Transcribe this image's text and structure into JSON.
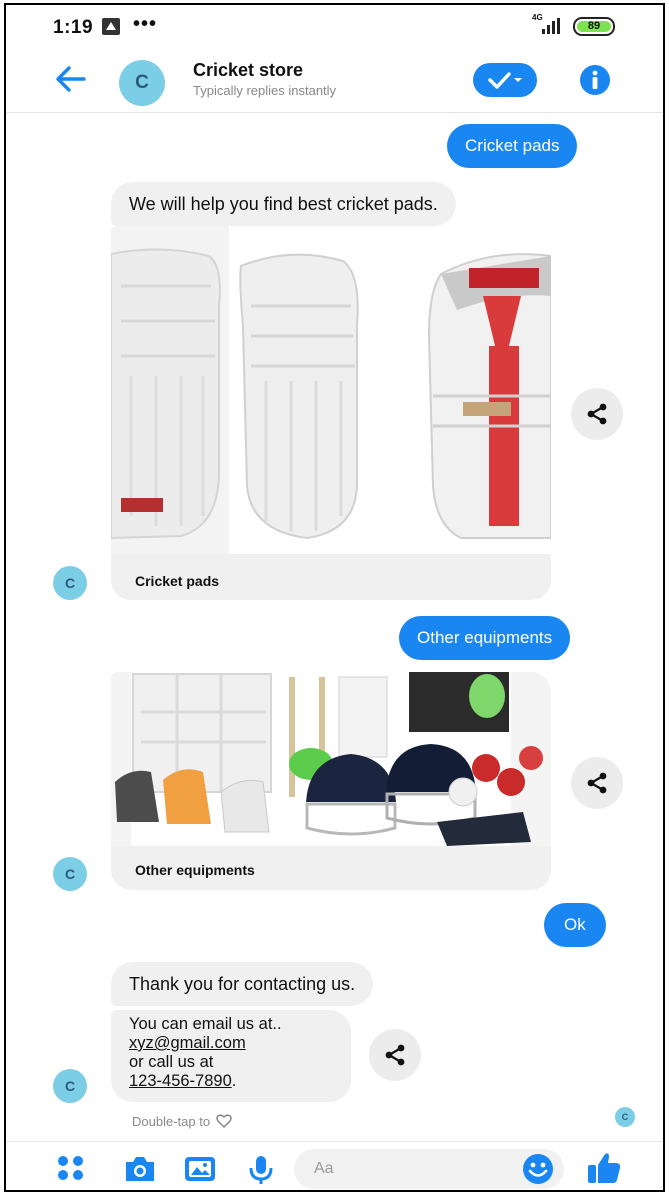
{
  "status_bar": {
    "time": "1:19",
    "more": "•••",
    "network": "4G",
    "battery": "89"
  },
  "header": {
    "avatar_letter": "C",
    "title": "Cricket store",
    "subtitle": "Typically replies instantly"
  },
  "messages": {
    "out_1": "Cricket pads",
    "in_1": "We will help you find best cricket pads.",
    "card_1_caption": "Cricket pads",
    "out_2": "Other equipments",
    "card_2_caption": "Other equipments",
    "out_3": "Ok",
    "in_2": "Thank you for contacting us.",
    "in_3_line1": "You can email us at..",
    "in_3_email": "xyz@gmail.com",
    "in_3_line3": "or call us at",
    "in_3_phone": "123-456-7890",
    "in_3_period": ".",
    "avatar_letter": "C"
  },
  "footer": {
    "double_tap": "Double-tap to"
  },
  "composer": {
    "placeholder": "Aa"
  },
  "colors": {
    "accent": "#1a86f2",
    "bubble_in": "#f0f0f0",
    "avatar": "#7ccde6"
  }
}
